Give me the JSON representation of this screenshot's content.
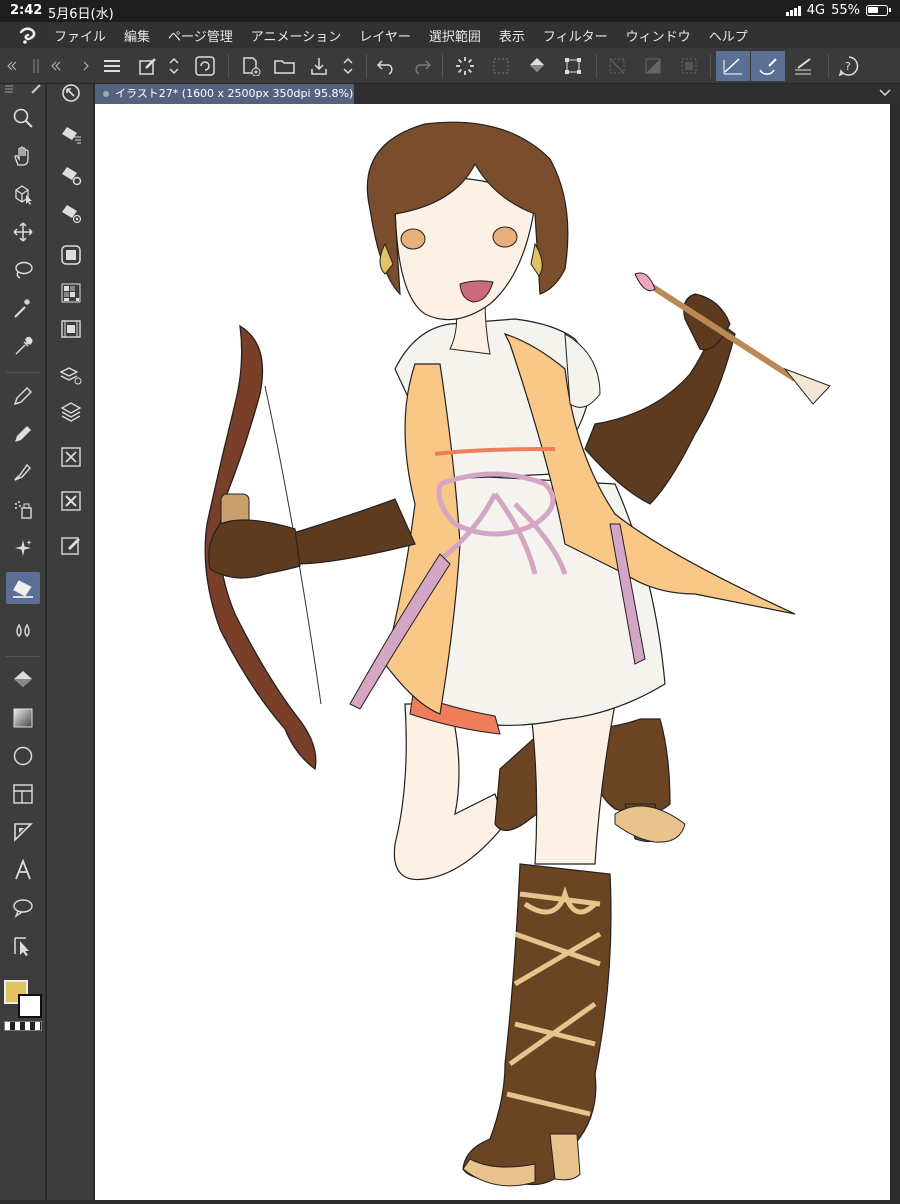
{
  "status": {
    "time": "2:42",
    "date": "5月6日(水)",
    "network": "4G",
    "battery": "55%"
  },
  "menubar": {
    "items": [
      "ファイル",
      "編集",
      "ページ管理",
      "アニメーション",
      "レイヤー",
      "選択範囲",
      "表示",
      "フィルター",
      "ウィンドウ",
      "ヘルプ"
    ]
  },
  "document": {
    "tab_title": "イラスト27* (1600 x 2500px 350dpi 95.8%)"
  },
  "colors": {
    "accent": "#5b6f95",
    "main_color": "#e2c361",
    "sub_color": "#ffffff"
  },
  "tools": [
    "zoom-icon",
    "hand-icon",
    "object-select-icon",
    "move-icon",
    "lasso-icon",
    "magic-wand-icon",
    "eyedropper-icon",
    "pen-icon",
    "pencil-icon",
    "brush-icon",
    "airbrush-icon",
    "decoration-icon",
    "eraser-icon",
    "blend-icon",
    "fill-icon",
    "gradient-icon",
    "figure-icon",
    "frame-icon",
    "ruler-icon",
    "text-icon",
    "balloon-icon",
    "correct-line-icon"
  ]
}
